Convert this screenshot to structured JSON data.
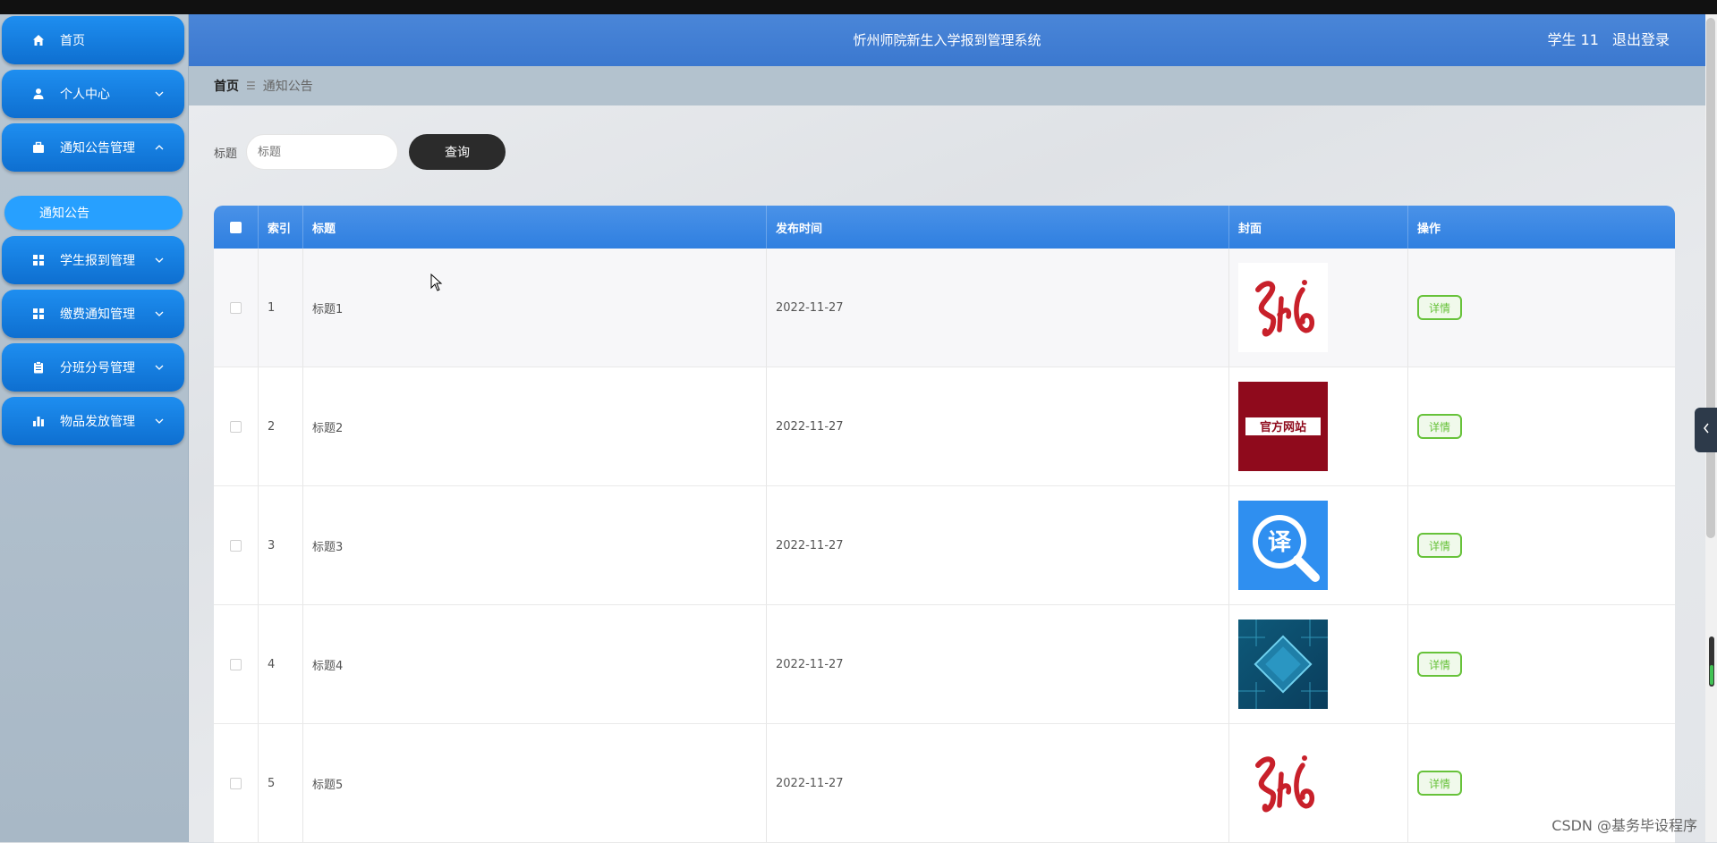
{
  "app": {
    "title": "忻州师院新生入学报到管理系统",
    "user_label": "学生 11",
    "logout_label": "退出登录"
  },
  "sidebar": {
    "items": [
      {
        "label": "首页",
        "icon": "home-icon",
        "expandable": false
      },
      {
        "label": "个人中心",
        "icon": "user-icon",
        "expandable": true,
        "chevron": "down"
      },
      {
        "label": "通知公告管理",
        "icon": "briefcase-icon",
        "expandable": true,
        "chevron": "up"
      },
      {
        "label": "学生报到管理",
        "icon": "grid-icon",
        "expandable": true,
        "chevron": "down"
      },
      {
        "label": "缴费通知管理",
        "icon": "grid-icon",
        "expandable": true,
        "chevron": "down"
      },
      {
        "label": "分班分号管理",
        "icon": "clipboard-icon",
        "expandable": true,
        "chevron": "down"
      },
      {
        "label": "物品发放管理",
        "icon": "bar-chart-icon",
        "expandable": true,
        "chevron": "down"
      }
    ],
    "submenu": {
      "label": "通知公告"
    }
  },
  "breadcrumb": {
    "home": "首页",
    "separator": "☰",
    "current": "通知公告"
  },
  "search": {
    "label": "标题",
    "placeholder": "标题",
    "button_label": "查询"
  },
  "table": {
    "columns": [
      "索引",
      "标题",
      "发布时间",
      "封面",
      "操作"
    ],
    "rows": [
      {
        "index": "1",
        "title": "标题1",
        "date": "2022-11-27",
        "cover": "script-logo-red",
        "action": "详情"
      },
      {
        "index": "2",
        "title": "标题2",
        "date": "2022-11-27",
        "cover": "official-site-banner",
        "action": "详情"
      },
      {
        "index": "3",
        "title": "标题3",
        "date": "2022-11-27",
        "cover": "translate-app-icon",
        "action": "详情"
      },
      {
        "index": "4",
        "title": "标题4",
        "date": "2022-11-27",
        "cover": "circuit-chip-image",
        "action": "详情"
      },
      {
        "index": "5",
        "title": "标题5",
        "date": "2022-11-27",
        "cover": "script-logo-red",
        "action": "详情"
      }
    ],
    "cover_texts": {
      "official_site": "官方网站",
      "translate": "译"
    }
  },
  "watermark": "CSDN @基务毕设程序",
  "colors": {
    "primary": "#1e8ef0",
    "header": "#3b78cf",
    "detail_button": "#67c23a"
  }
}
